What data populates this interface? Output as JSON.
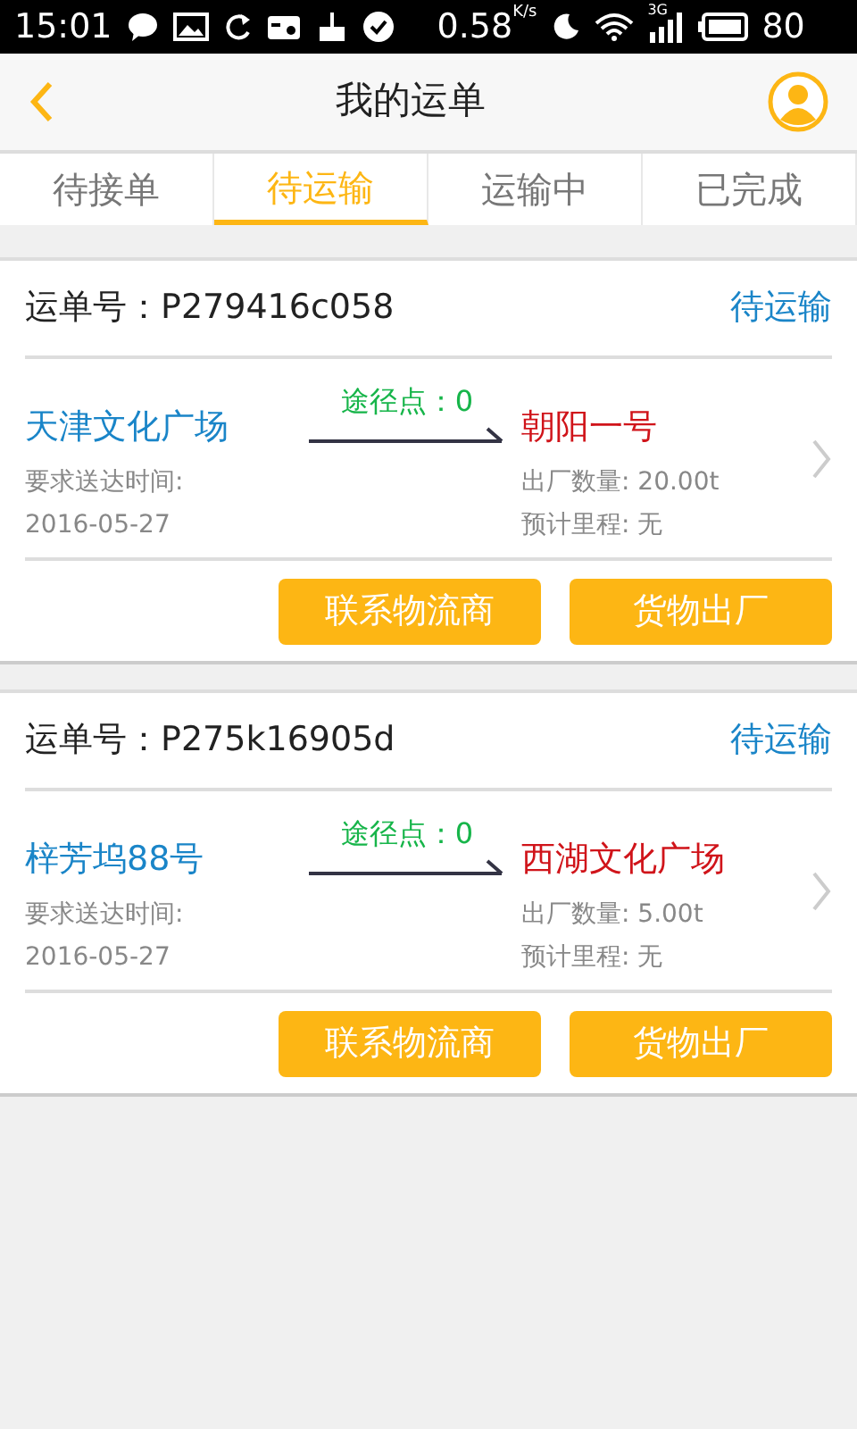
{
  "status_bar": {
    "time": "15:01",
    "speed": "0.58",
    "speed_unit": "K/s",
    "network": "3G",
    "battery": "80"
  },
  "header": {
    "title": "我的运单"
  },
  "tabs": [
    {
      "label": "待接单",
      "selected": false
    },
    {
      "label": "待运输",
      "selected": true
    },
    {
      "label": "运输中",
      "selected": false
    },
    {
      "label": "已完成",
      "selected": false
    }
  ],
  "orders": [
    {
      "order_label": "运单号：",
      "order_no": "P279416c058",
      "status": "待运输",
      "origin": "天津文化广场",
      "waypoints": "途径点：0",
      "destination": "朝阳一号",
      "deadline_label": "要求送达时间:",
      "deadline": "2016-05-27",
      "quantity": "出厂数量: 20.00t",
      "distance": "预计里程: 无",
      "buttons": [
        "联系物流商",
        "货物出厂"
      ]
    },
    {
      "order_label": "运单号：",
      "order_no": "P275k16905d",
      "status": "待运输",
      "origin": "梓芳坞88号",
      "waypoints": "途径点：0",
      "destination": "西湖文化广场",
      "deadline_label": "要求送达时间:",
      "deadline": "2016-05-27",
      "quantity": "出厂数量: 5.00t",
      "distance": "预计里程: 无",
      "buttons": [
        "联系物流商",
        "货物出厂"
      ]
    }
  ]
}
